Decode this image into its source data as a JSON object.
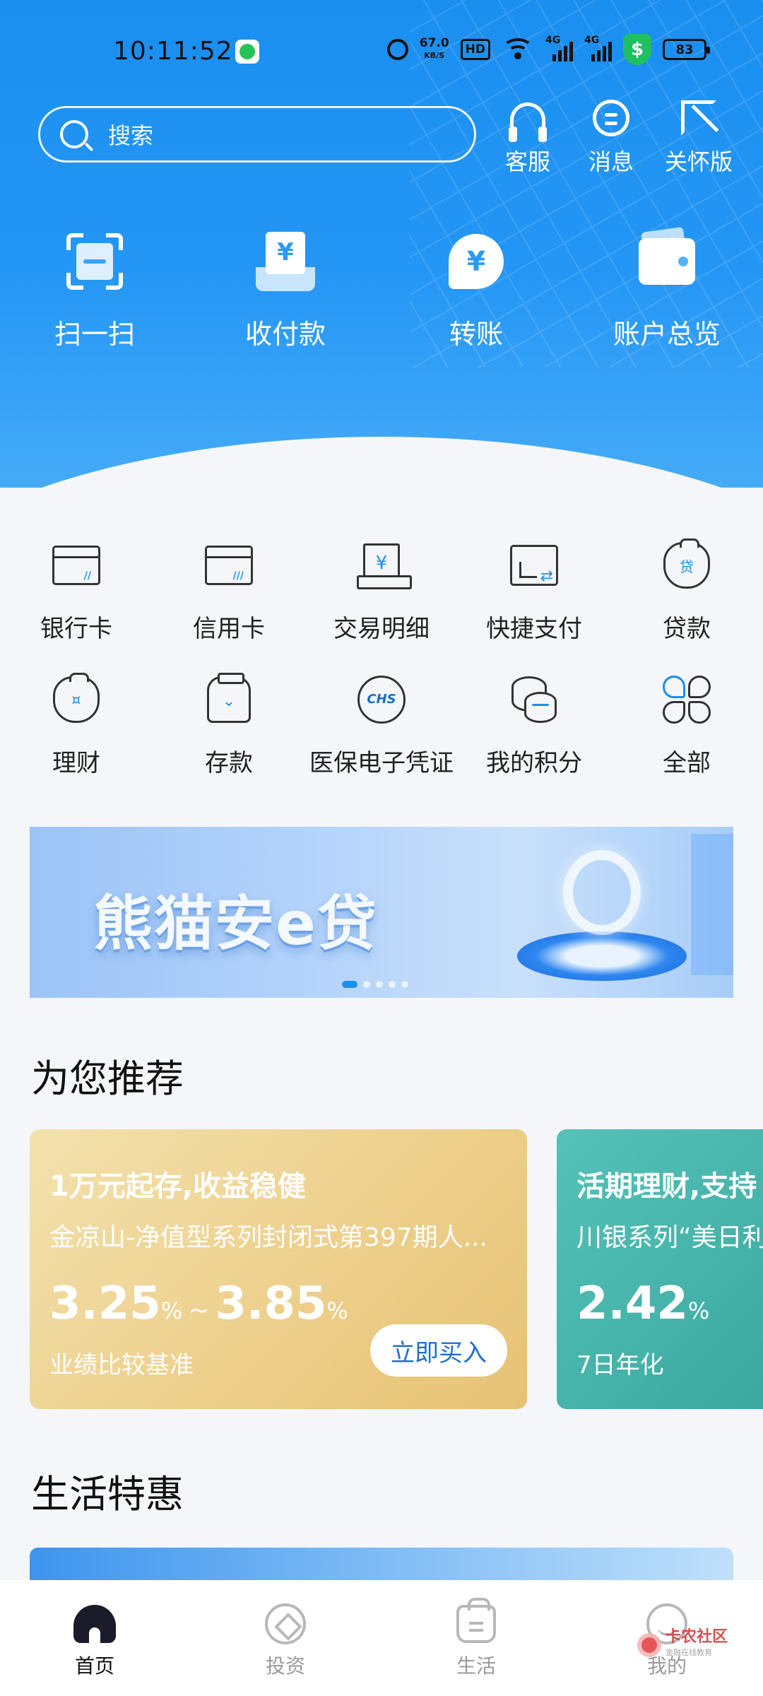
{
  "status_bar": {
    "time": "10:11:52",
    "net_speed_value": "67.0",
    "net_speed_unit": "KB/S",
    "hd_label": "HD",
    "signal_1_label": "4G",
    "signal_2_label": "4G",
    "shield_symbol": "$",
    "battery": "83"
  },
  "search": {
    "placeholder": "搜索"
  },
  "top_actions": [
    {
      "label": "客服",
      "icon": "headset-icon"
    },
    {
      "label": "消息",
      "icon": "message-icon"
    },
    {
      "label": "关怀版",
      "icon": "care-mode-icon"
    }
  ],
  "quick_actions": [
    {
      "label": "扫一扫",
      "icon": "scan-icon"
    },
    {
      "label": "收付款",
      "icon": "payment-code-icon",
      "glyph": "¥"
    },
    {
      "label": "转账",
      "icon": "transfer-icon",
      "glyph": "¥"
    },
    {
      "label": "账户总览",
      "icon": "wallet-icon"
    }
  ],
  "functions": [
    {
      "label": "银行卡",
      "icon": "bank-card-icon"
    },
    {
      "label": "信用卡",
      "icon": "credit-card-icon"
    },
    {
      "label": "交易明细",
      "icon": "transaction-detail-icon",
      "glyph": "¥"
    },
    {
      "label": "快捷支付",
      "icon": "quick-pay-icon"
    },
    {
      "label": "贷款",
      "icon": "loan-icon",
      "glyph": "贷"
    },
    {
      "label": "理财",
      "icon": "wealth-icon",
      "glyph": "¤"
    },
    {
      "label": "存款",
      "icon": "deposit-icon",
      "glyph": "⌄"
    },
    {
      "label": "医保电子凭证",
      "icon": "medical-insurance-icon",
      "glyph": "CHS"
    },
    {
      "label": "我的积分",
      "icon": "points-icon"
    },
    {
      "label": "全部",
      "icon": "all-services-icon"
    }
  ],
  "banner": {
    "title": "熊猫安e贷",
    "slide_count": 5,
    "active_slide": 1
  },
  "recommend": {
    "title": "为您推荐",
    "cards": [
      {
        "headline": "1万元起存,收益稳健",
        "product": "金凉山-净值型系列封闭式第397期人...",
        "rate_low": "3.25",
        "rate_high": "3.85",
        "rate_unit": "%",
        "rate_sep": "~",
        "rate_note": "业绩比较基准",
        "button": "立即买入"
      },
      {
        "headline": "活期理财,支持",
        "product": "川银系列“美日利",
        "rate": "2.42",
        "rate_unit": "%",
        "rate_note": "7日年化"
      }
    ]
  },
  "life": {
    "title": "生活特惠"
  },
  "tabbar": {
    "tabs": [
      {
        "label": "首页",
        "icon": "home-icon",
        "active": true
      },
      {
        "label": "投资",
        "icon": "invest-icon",
        "active": false
      },
      {
        "label": "生活",
        "icon": "life-icon",
        "active": false
      },
      {
        "label": "我的",
        "icon": "profile-icon",
        "active": false
      }
    ]
  },
  "watermark": {
    "name": "卡农社区",
    "sub": "金融在线教育"
  },
  "colors": {
    "header_blue": "#1a8ff0",
    "gold_card": "#eed18f",
    "teal_card": "#3aa89e",
    "accent_blue": "#1f6fd0"
  }
}
